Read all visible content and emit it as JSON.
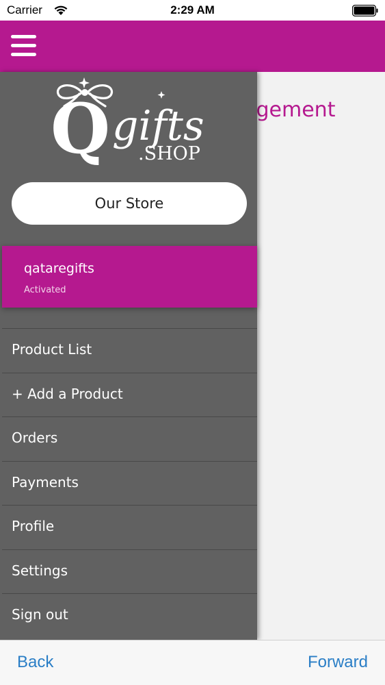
{
  "status_bar": {
    "carrier": "Carrier",
    "time": "2:29 AM"
  },
  "colors": {
    "brand": "#b5198f",
    "drawer": "#616161",
    "link": "#2a7ec6"
  },
  "header": {
    "menu_icon": "hamburger-icon"
  },
  "main": {
    "title_fragment": "Store Management"
  },
  "drawer": {
    "logo": {
      "letter": "Q",
      "word": "gifts",
      "suffix": ".SHOP"
    },
    "store_button": "Our Store",
    "account": {
      "name": "qataregifts",
      "status": "Activated"
    },
    "menu": [
      {
        "label": "Product List"
      },
      {
        "label": "+ Add a Product"
      },
      {
        "label": "Orders"
      },
      {
        "label": "Payments"
      },
      {
        "label": "Profile"
      },
      {
        "label": "Settings"
      },
      {
        "label": "Sign out"
      }
    ]
  },
  "bottom_bar": {
    "back": "Back",
    "forward": "Forward"
  }
}
